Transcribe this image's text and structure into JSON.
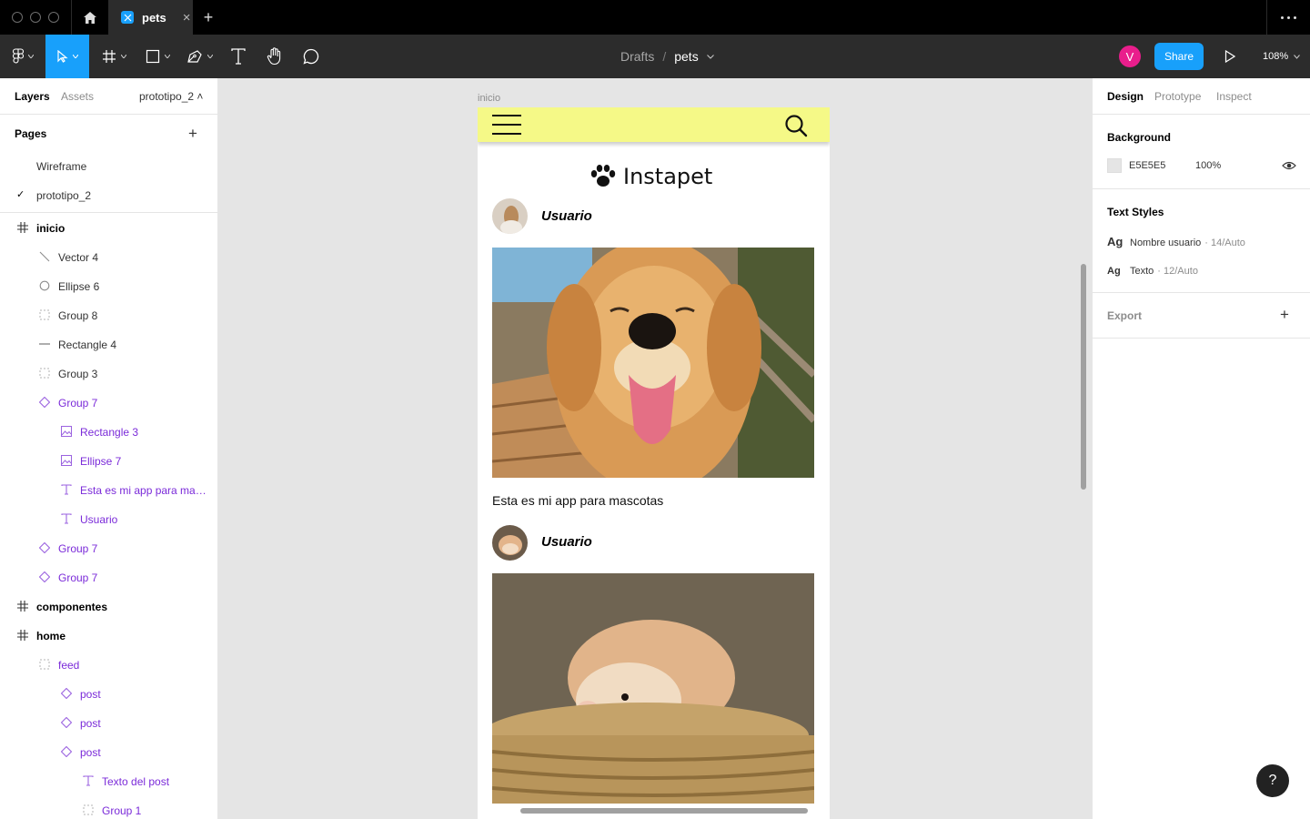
{
  "titlebar": {
    "tab_name": "pets",
    "close_glyph": "×",
    "new_tab_glyph": "+"
  },
  "toolbar": {
    "breadcrumb_drafts": "Drafts",
    "breadcrumb_separator": "/",
    "file_name": "pets",
    "avatar_initial": "V",
    "share_label": "Share",
    "zoom_level": "108%",
    "accent_color": "#18a0fb",
    "avatar_color": "#e91e8c"
  },
  "left_panel": {
    "tabs": [
      "Layers",
      "Assets"
    ],
    "page_select": "prototipo_2 ˄",
    "pages_title": "Pages",
    "add_glyph": "+",
    "pages": [
      {
        "label": "Wireframe",
        "selected": false
      },
      {
        "label": "prototipo_2",
        "selected": true
      }
    ],
    "check_glyph": "✓",
    "layers": [
      {
        "label": "inicio",
        "icon": "frame-icon"
      },
      {
        "label": "Vector 4",
        "icon": "vector-icon"
      },
      {
        "label": "Ellipse 6",
        "icon": "ellipse-icon"
      },
      {
        "label": "Group 8",
        "icon": "group-icon"
      },
      {
        "label": "Rectangle 4",
        "icon": "line-icon"
      },
      {
        "label": "Group 3",
        "icon": "group-icon"
      },
      {
        "label": "Group 7",
        "icon": "instance-icon"
      },
      {
        "label": "Rectangle 3",
        "icon": "image-icon"
      },
      {
        "label": "Ellipse 7",
        "icon": "image-icon"
      },
      {
        "label": "Esta es mi app para masc...",
        "icon": "text-icon"
      },
      {
        "label": "Usuario",
        "icon": "text-icon"
      },
      {
        "label": "Group 7",
        "icon": "instance-icon"
      },
      {
        "label": "Group 7",
        "icon": "instance-icon"
      },
      {
        "label": "componentes",
        "icon": "frame-icon"
      },
      {
        "label": "home",
        "icon": "frame-icon"
      },
      {
        "label": "feed",
        "icon": "group-icon"
      },
      {
        "label": "post",
        "icon": "instance-icon"
      },
      {
        "label": "post",
        "icon": "instance-icon"
      },
      {
        "label": "post",
        "icon": "instance-icon"
      },
      {
        "label": "Texto del post",
        "icon": "text-icon"
      },
      {
        "label": "Group 1",
        "icon": "group-icon"
      }
    ]
  },
  "canvas": {
    "frame_label": "inicio",
    "app_logo_text": "Instapet",
    "header_color": "#f5f987",
    "posts": [
      {
        "user": "Usuario",
        "caption": "Esta es mi app para mascotas",
        "photo": "golden-retriever-photo"
      },
      {
        "user": "Usuario",
        "caption": "",
        "photo": "hamster-photo"
      }
    ]
  },
  "right_panel": {
    "tabs": [
      "Design",
      "Prototype",
      "Inspect"
    ],
    "background_title": "Background",
    "background_hex": "E5E5E5",
    "background_opacity": "100%",
    "background_color": "#e5e5e5",
    "text_styles_title": "Text Styles",
    "text_styles": [
      {
        "ag": "Ag",
        "name": "Nombre usuario",
        "meta": "· 14/Auto"
      },
      {
        "ag": "Ag",
        "name": "Texto",
        "meta": "· 12/Auto"
      }
    ],
    "export_title": "Export",
    "add_glyph": "+",
    "help_glyph": "?"
  }
}
